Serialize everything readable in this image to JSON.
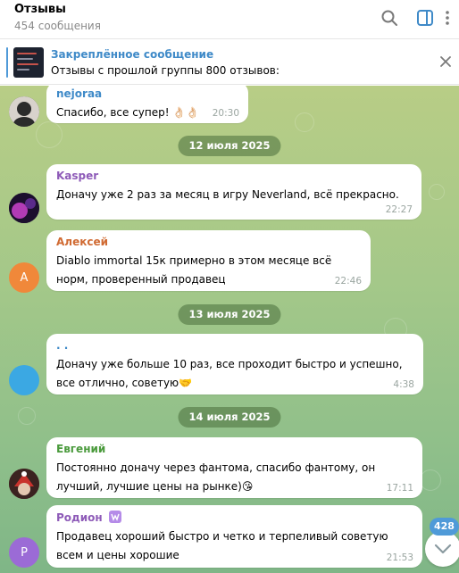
{
  "header": {
    "title": "Отзывы",
    "subtitle": "454 сообщения"
  },
  "pinned": {
    "title": "Закреплённое сообщение",
    "text": "Отзывы с прошлой группы 800 отзывов:"
  },
  "messages": [
    {
      "sender": "nejoraa",
      "text": "Спасибо, все супер! 👌🏻👌🏻",
      "time": "20:30",
      "sender_color": "#3f8ac8"
    },
    {
      "sender": "Kasper",
      "text": "Доначу уже 2 раз за месяц в игру Neverland, всё прекрасно.",
      "time": "22:27",
      "sender_color": "#8e5bb8"
    },
    {
      "sender": "Алексей",
      "text": "Diablo immortal 15к примерно в этом месяце всё норм, проверенный продавец",
      "time": "22:46",
      "sender_color": "#d06a32",
      "avatar_letter": "А"
    },
    {
      "sender": ". .",
      "text": "Доначу уже больше 10 раз, все проходит быстро и успешно, все отлично, советую🤝",
      "time": "4:38",
      "sender_color": "#3f8ac8"
    },
    {
      "sender": "Евгений",
      "text": "Постоянно доначу через фантома, спасибо фантому, он лучший, лучшие цены на рынке)😘",
      "time": "17:11",
      "sender_color": "#4a9a3c"
    },
    {
      "sender": "Родион",
      "text": "Продавец хороший быстро и четко и терпеливый советую всем и цены хорошие",
      "time": "21:53",
      "sender_color": "#8e5bb8",
      "avatar_letter": "Р"
    }
  ],
  "dates": [
    "12 июля 2025",
    "13 июля 2025",
    "14 июля 2025"
  ],
  "unread_count": "428",
  "colors": {
    "accent": "#4f9ad8",
    "chat_background": "#a4c889"
  }
}
